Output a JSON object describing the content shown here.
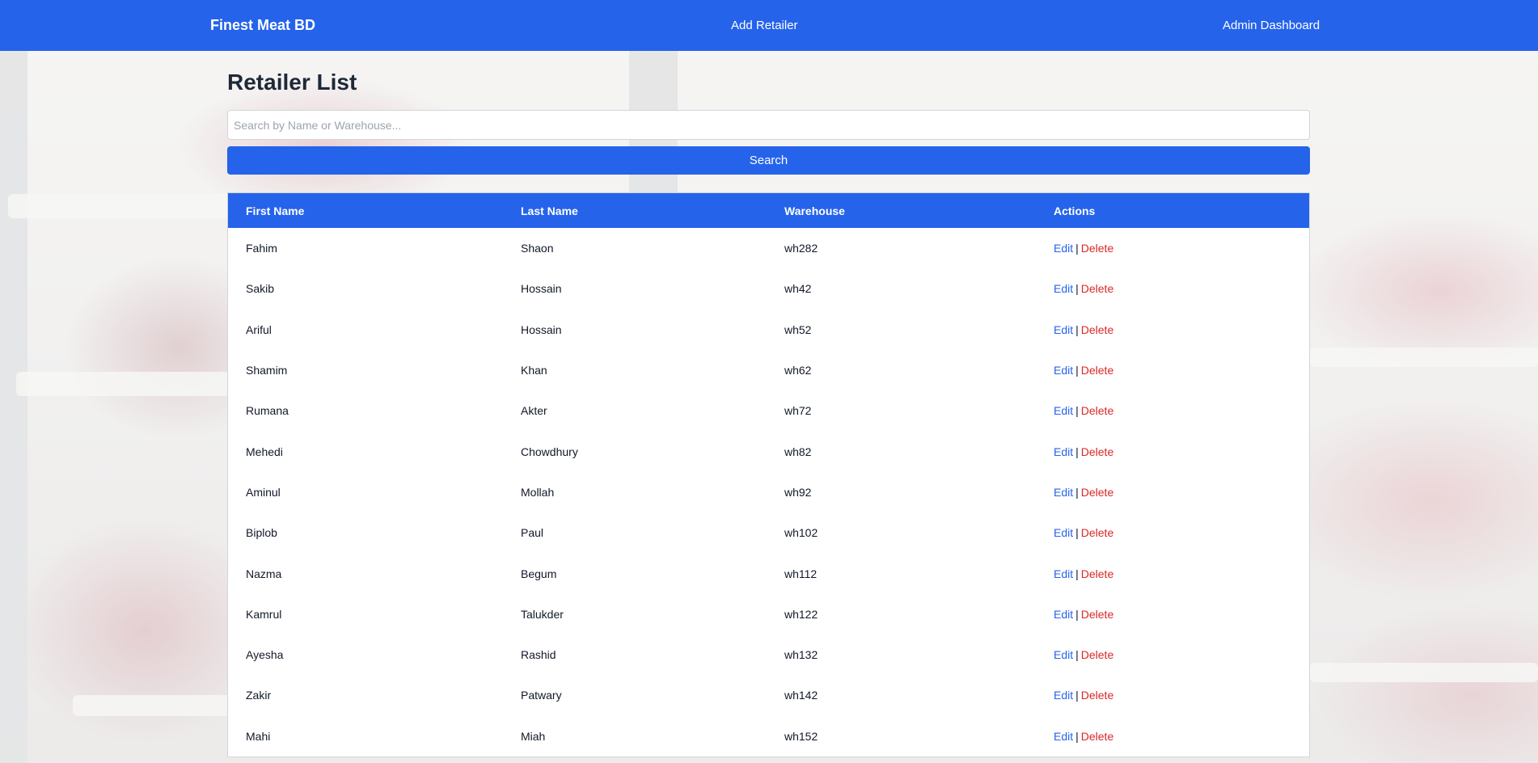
{
  "navbar": {
    "brand": "Finest Meat BD",
    "add_retailer": "Add Retailer",
    "admin_dashboard": "Admin Dashboard"
  },
  "page": {
    "title": "Retailer List"
  },
  "search": {
    "placeholder": "Search by Name or Warehouse...",
    "value": "",
    "button_label": "Search"
  },
  "table": {
    "headers": [
      "First Name",
      "Last Name",
      "Warehouse",
      "Actions"
    ],
    "edit_label": "Edit",
    "separator": "|",
    "delete_label": "Delete",
    "rows": [
      {
        "first_name": "Fahim",
        "last_name": "Shaon",
        "warehouse": "wh282"
      },
      {
        "first_name": "Sakib",
        "last_name": "Hossain",
        "warehouse": "wh42"
      },
      {
        "first_name": "Ariful",
        "last_name": "Hossain",
        "warehouse": "wh52"
      },
      {
        "first_name": "Shamim",
        "last_name": "Khan",
        "warehouse": "wh62"
      },
      {
        "first_name": "Rumana",
        "last_name": "Akter",
        "warehouse": "wh72"
      },
      {
        "first_name": "Mehedi",
        "last_name": "Chowdhury",
        "warehouse": "wh82"
      },
      {
        "first_name": "Aminul",
        "last_name": "Mollah",
        "warehouse": "wh92"
      },
      {
        "first_name": "Biplob",
        "last_name": "Paul",
        "warehouse": "wh102"
      },
      {
        "first_name": "Nazma",
        "last_name": "Begum",
        "warehouse": "wh112"
      },
      {
        "first_name": "Kamrul",
        "last_name": "Talukder",
        "warehouse": "wh122"
      },
      {
        "first_name": "Ayesha",
        "last_name": "Rashid",
        "warehouse": "wh132"
      },
      {
        "first_name": "Zakir",
        "last_name": "Patwary",
        "warehouse": "wh142"
      },
      {
        "first_name": "Mahi",
        "last_name": "Miah",
        "warehouse": "wh152"
      }
    ]
  },
  "colors": {
    "primary": "#2563eb",
    "delete": "#dc2626",
    "title": "#1f2937"
  }
}
